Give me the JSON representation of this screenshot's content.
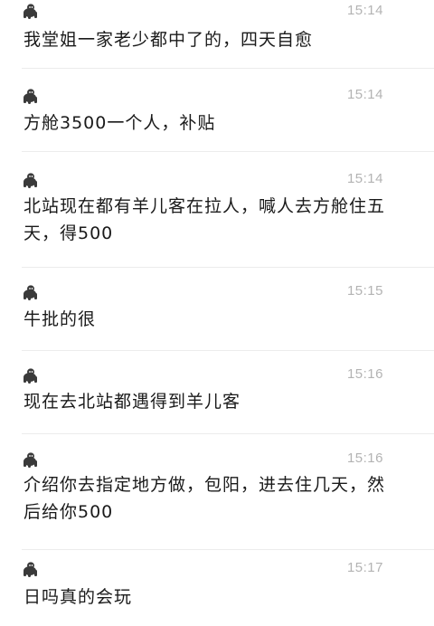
{
  "messages": [
    {
      "time": "15:14",
      "text": "我堂姐一家老少都中了的，四天自愈"
    },
    {
      "time": "15:14",
      "text": "方舱3500一个人，补贴"
    },
    {
      "time": "15:14",
      "text": "北站现在都有羊儿客在拉人，喊人去方舱住五天，得500"
    },
    {
      "time": "15:15",
      "text": "牛批的很"
    },
    {
      "time": "15:16",
      "text": "现在去北站都遇得到羊儿客"
    },
    {
      "time": "15:16",
      "text": "介绍你去指定地方做，包阳，进去住几天，然后给你500"
    },
    {
      "time": "15:17",
      "text": "日吗真的会玩"
    }
  ],
  "avatar_icon": "gorilla-icon"
}
